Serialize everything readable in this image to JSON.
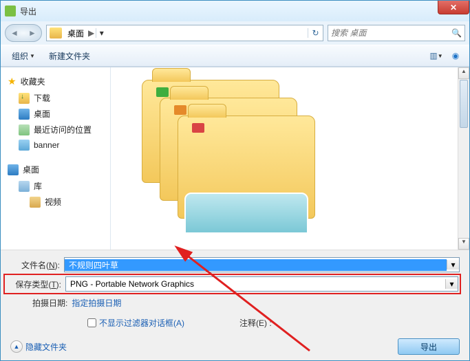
{
  "window": {
    "title": "导出"
  },
  "nav": {
    "crumb": "桌面",
    "search_placeholder": "搜索 桌面"
  },
  "toolbar": {
    "organize": "组织",
    "new_folder": "新建文件夹"
  },
  "sidebar": {
    "favorites": "收藏夹",
    "items_fav": [
      {
        "label": "下载"
      },
      {
        "label": "桌面"
      },
      {
        "label": "最近访问的位置"
      },
      {
        "label": "banner"
      }
    ],
    "desktop": "桌面",
    "library": "库",
    "video": "视频"
  },
  "form": {
    "filename_label_pre": "文件名(",
    "filename_label_ul": "N",
    "filename_label_post": "):",
    "filename_value": "不规则四叶草",
    "savetype_label_pre": "保存类型(",
    "savetype_label_ul": "T",
    "savetype_label_post": "):",
    "savetype_value": "PNG - Portable Network Graphics",
    "shotdate_label": "拍摄日期:",
    "shotdate_value": "指定拍摄日期",
    "filter_checkbox_pre": "不显示过滤器对话框(",
    "filter_checkbox_ul": "A",
    "filter_checkbox_post": ")",
    "comment_label_pre": "注释(",
    "comment_label_ul": "E",
    "comment_label_post": ") :"
  },
  "footer": {
    "hide_folders": "隐藏文件夹",
    "export": "导出"
  }
}
